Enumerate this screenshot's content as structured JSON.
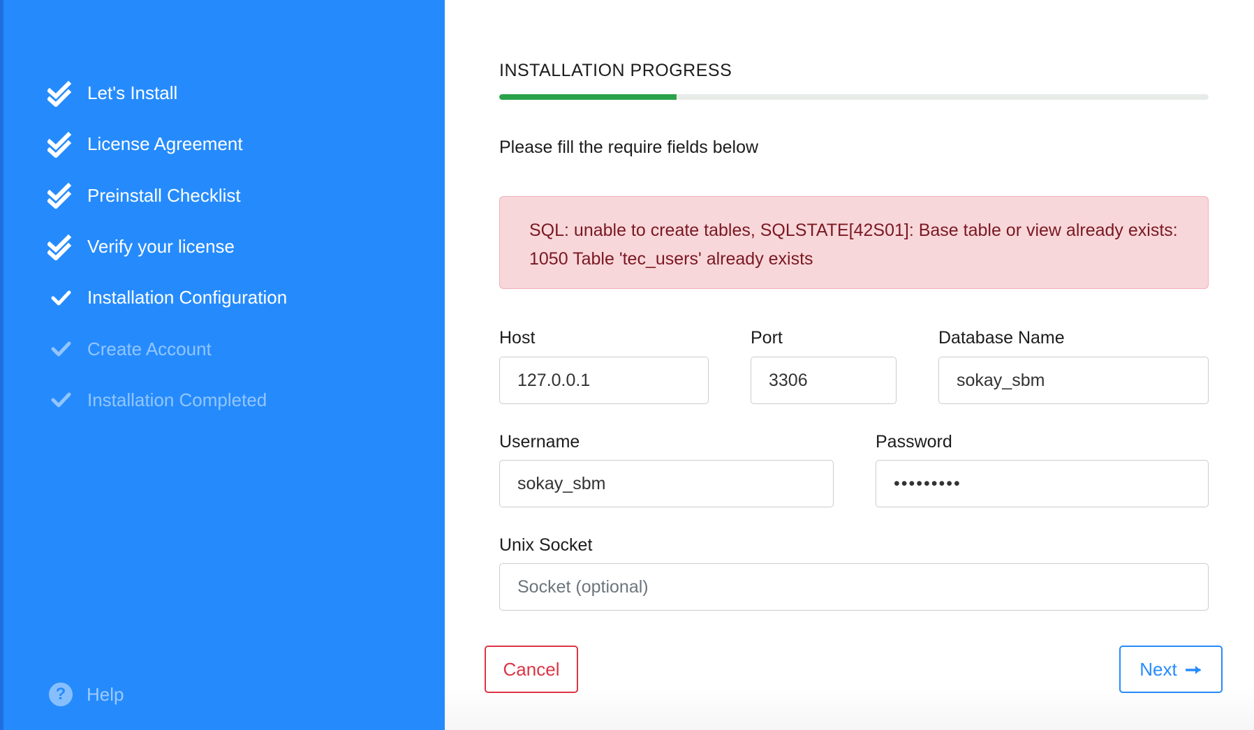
{
  "sidebar": {
    "steps": [
      {
        "label": "Let's Install",
        "state": "done"
      },
      {
        "label": "License Agreement",
        "state": "done"
      },
      {
        "label": "Preinstall Checklist",
        "state": "done"
      },
      {
        "label": "Verify your license",
        "state": "done"
      },
      {
        "label": "Installation Configuration",
        "state": "current"
      },
      {
        "label": "Create Account",
        "state": "pending"
      },
      {
        "label": "Installation Completed",
        "state": "pending"
      }
    ],
    "help_label": "Help",
    "help_icon": "question-circle-icon"
  },
  "main": {
    "progress_title": "INSTALLATION PROGRESS",
    "progress_fraction": 0.25,
    "intro": "Please fill the require fields below",
    "error_message": "SQL: unable to create tables, SQLSTATE[42S01]: Base table or view already exists: 1050 Table 'tec_users' already exists",
    "fields": {
      "host": {
        "label": "Host",
        "value": "127.0.0.1"
      },
      "port": {
        "label": "Port",
        "value": "3306"
      },
      "database_name": {
        "label": "Database Name",
        "value": "sokay_sbm"
      },
      "username": {
        "label": "Username",
        "value": "sokay_sbm"
      },
      "password": {
        "label": "Password",
        "value": "•••••••••"
      },
      "unix_socket": {
        "label": "Unix Socket",
        "value": "",
        "placeholder": "Socket (optional)"
      }
    },
    "buttons": {
      "cancel_label": "Cancel",
      "next_label": "Next",
      "next_icon": "arrow-right-icon"
    }
  },
  "colors": {
    "sidebar_bg": "#258bfd",
    "progress_fill": "#2aa249",
    "error_bg": "#f8d7da",
    "error_text": "#7a1822",
    "cancel": "#dc3545",
    "next": "#258bfd"
  }
}
